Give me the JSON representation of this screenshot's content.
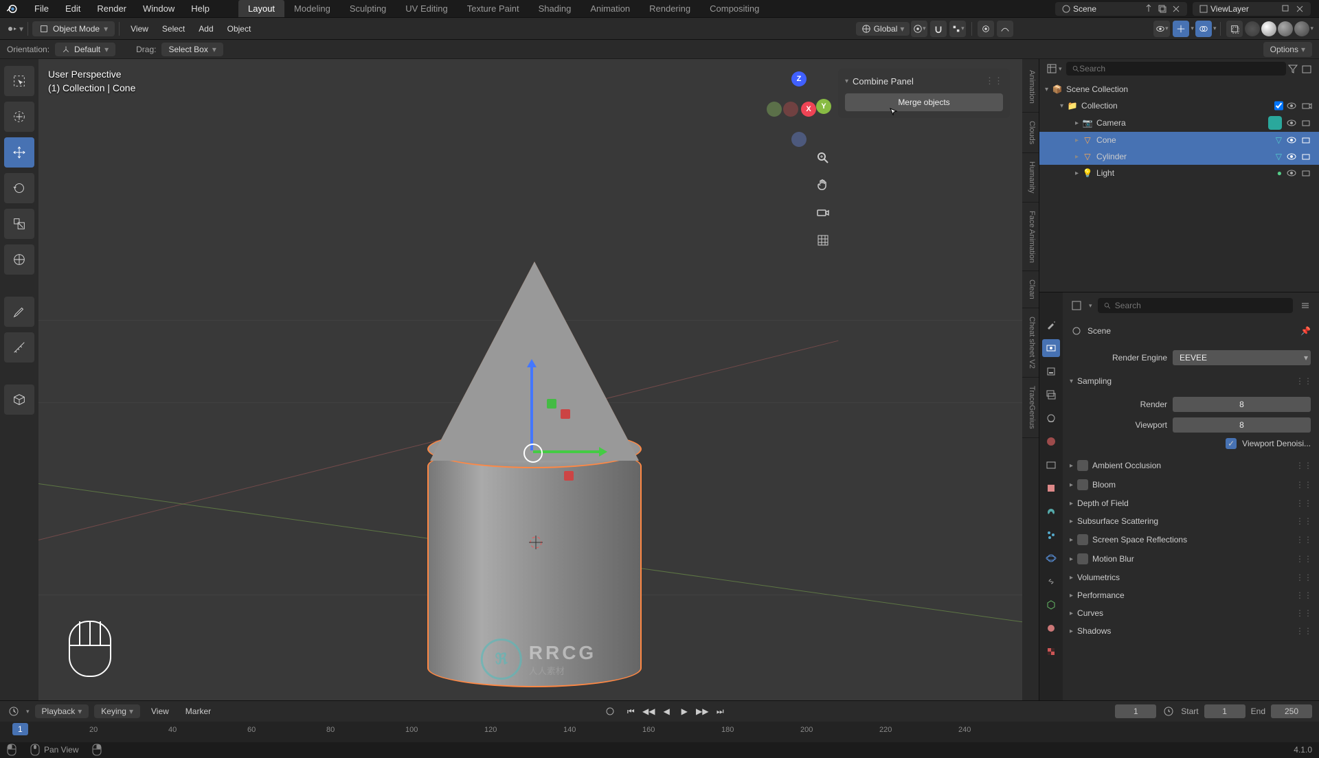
{
  "top_menu": [
    "File",
    "Edit",
    "Render",
    "Window",
    "Help"
  ],
  "workspace_tabs": [
    "Layout",
    "Modeling",
    "Sculpting",
    "UV Editing",
    "Texture Paint",
    "Shading",
    "Animation",
    "Rendering",
    "Compositing"
  ],
  "active_tab": "Layout",
  "scene_name": "Scene",
  "viewlayer_name": "ViewLayer",
  "mode": "Object Mode",
  "header_menus": [
    "View",
    "Select",
    "Add",
    "Object"
  ],
  "transform_orient": "Global",
  "third_bar": {
    "orientation_label": "Orientation:",
    "orientation_value": "Default",
    "drag_label": "Drag:",
    "drag_value": "Select Box"
  },
  "options_label": "Options",
  "viewport": {
    "title": "User Perspective",
    "subtitle": "(1) Collection | Cone",
    "axes": {
      "x": "X",
      "y": "Y",
      "z": "Z"
    }
  },
  "side_tabs": [
    "Animation",
    "Clouds",
    "Humanity",
    "Face Animation",
    "Clean",
    "Cheat sheet V2",
    "TraceGenius"
  ],
  "combine_panel": {
    "title": "Combine Panel",
    "button": "Merge objects"
  },
  "outliner": {
    "search_placeholder": "Search",
    "root": "Scene Collection",
    "collection": "Collection",
    "items": [
      {
        "name": "Camera",
        "type": "camera"
      },
      {
        "name": "Cone",
        "type": "mesh",
        "selected": true
      },
      {
        "name": "Cylinder",
        "type": "mesh",
        "selected": true
      },
      {
        "name": "Light",
        "type": "light"
      }
    ]
  },
  "properties": {
    "search_placeholder": "Search",
    "breadcrumb": "Scene",
    "render_engine_label": "Render Engine",
    "render_engine_value": "EEVEE",
    "sampling_label": "Sampling",
    "render_label": "Render",
    "render_value": "8",
    "viewport_label": "Viewport",
    "viewport_value": "8",
    "viewport_denoise": "Viewport Denoisi...",
    "sections": [
      "Ambient Occlusion",
      "Bloom",
      "Depth of Field",
      "Subsurface Scattering",
      "Screen Space Reflections",
      "Motion Blur",
      "Volumetrics",
      "Performance",
      "Curves",
      "Shadows"
    ]
  },
  "timeline": {
    "playback": "Playback",
    "keying": "Keying",
    "view": "View",
    "marker": "Marker",
    "current": "1",
    "start_label": "Start",
    "start": "1",
    "end_label": "End",
    "end": "250",
    "marker_frame": "1",
    "ticks": [
      "20",
      "40",
      "60",
      "80",
      "100",
      "120",
      "140",
      "160",
      "180",
      "200",
      "220",
      "240"
    ]
  },
  "status": {
    "pan": "Pan View"
  },
  "version": "4.1.0",
  "watermark": {
    "logo": "ℜ",
    "text": "RRCG",
    "sub": "人人素材"
  }
}
